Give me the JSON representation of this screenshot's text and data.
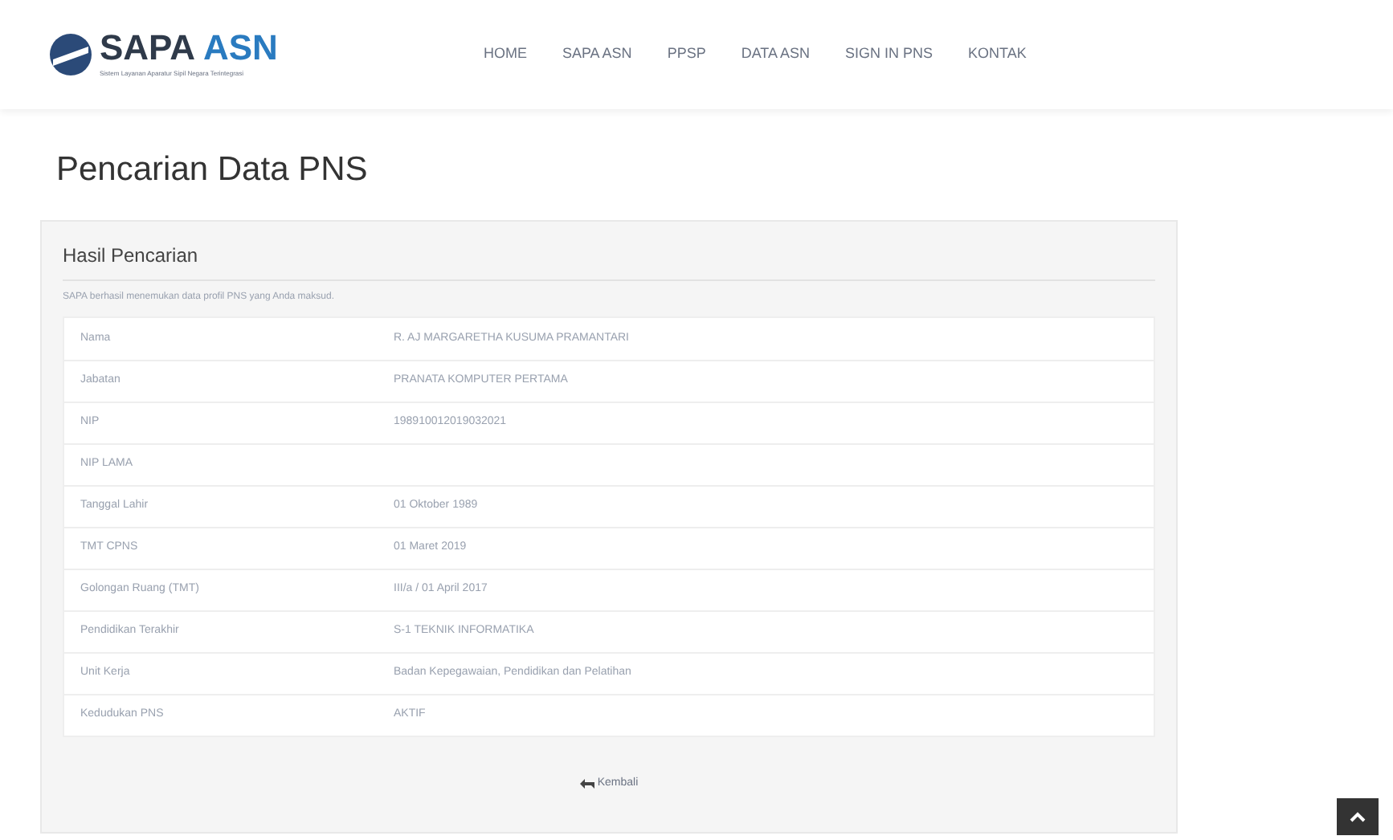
{
  "header": {
    "logo": {
      "name_part_1": "SAPA",
      "name_part_2": "ASN",
      "tagline": "Sistem Layanan Aparatur Sipil Negara Terintegrasi"
    },
    "nav": [
      {
        "label": "HOME"
      },
      {
        "label": "SAPA ASN"
      },
      {
        "label": "PPSP"
      },
      {
        "label": "DATA ASN"
      },
      {
        "label": "SIGN IN PNS"
      },
      {
        "label": "KONTAK"
      }
    ]
  },
  "page_title": "Pencarian Data PNS",
  "panel": {
    "title": "Hasil Pencarian",
    "subtitle": "SAPA berhasil menemukan data profil PNS yang Anda maksud.",
    "rows": [
      {
        "label": "Nama",
        "value": "R. AJ MARGARETHA KUSUMA PRAMANTARI"
      },
      {
        "label": "Jabatan",
        "value": "PRANATA KOMPUTER PERTAMA"
      },
      {
        "label": "NIP",
        "value": "198910012019032021"
      },
      {
        "label": "NIP LAMA",
        "value": ""
      },
      {
        "label": "Tanggal Lahir",
        "value": "01 Oktober 1989"
      },
      {
        "label": "TMT CPNS",
        "value": "01 Maret 2019"
      },
      {
        "label": "Golongan Ruang (TMT)",
        "value": "III/a  / 01 April 2017"
      },
      {
        "label": "Pendidikan Terakhir",
        "value": "S-1 TEKNIK INFORMATIKA"
      },
      {
        "label": "Unit Kerja",
        "value": "Badan Kepegawaian, Pendidikan dan Pelatihan"
      },
      {
        "label": "Kedudukan PNS",
        "value": "AKTIF"
      }
    ],
    "back_button": "Kembali"
  }
}
